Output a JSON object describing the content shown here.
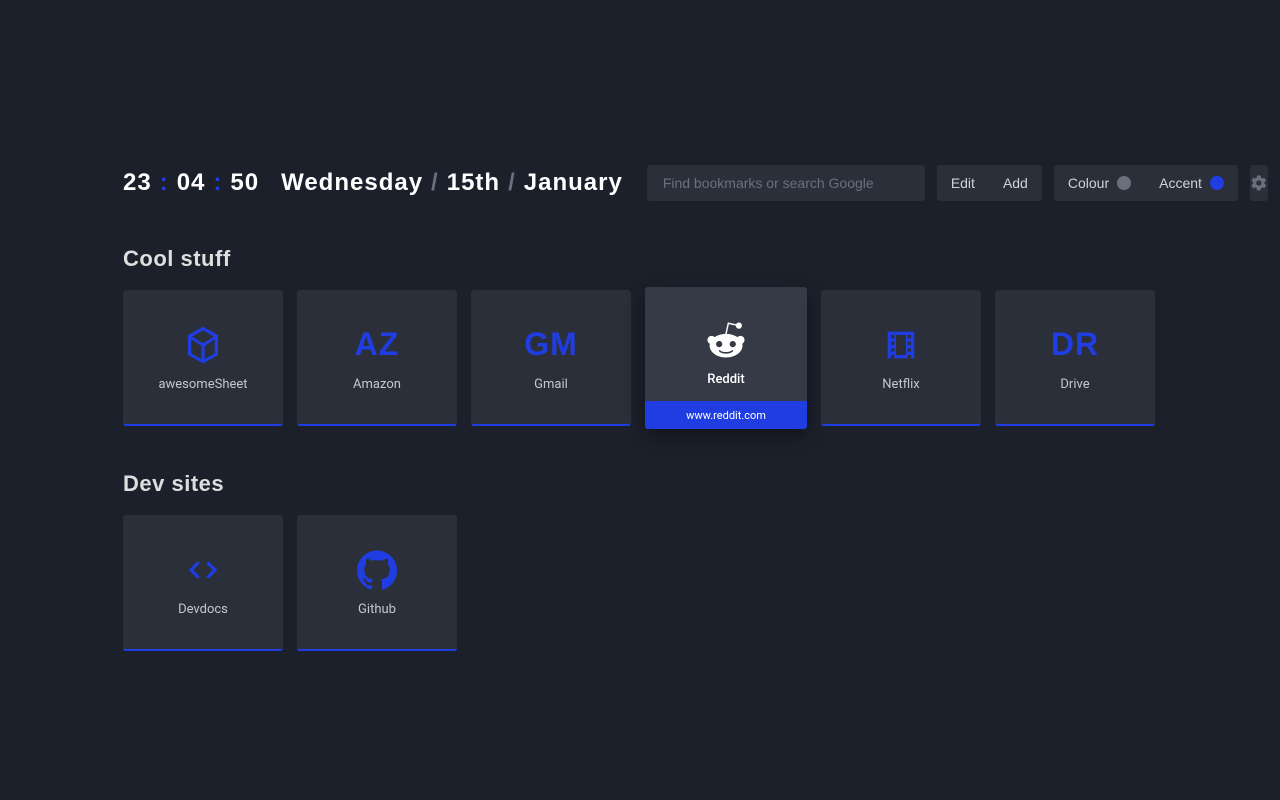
{
  "clock": {
    "hours": "23",
    "minutes": "04",
    "seconds": "50",
    "day": "Wednesday",
    "date": "15th",
    "month": "January"
  },
  "search": {
    "placeholder": "Find bookmarks or search Google"
  },
  "actions": {
    "edit": "Edit",
    "add": "Add",
    "colour": "Colour",
    "accent": "Accent"
  },
  "colors": {
    "accent": "#1f3de0",
    "colour_swatch": "#6a6f7e",
    "bg": "#1c202b",
    "tile": "#2b2f3a"
  },
  "sections": [
    {
      "title": "Cool stuff",
      "tiles": [
        {
          "label": "awesomeSheet",
          "display": "icon",
          "icon": "d20",
          "hover": false
        },
        {
          "label": "Amazon",
          "display": "text",
          "text": "AZ",
          "hover": false
        },
        {
          "label": "Gmail",
          "display": "text",
          "text": "GM",
          "hover": false
        },
        {
          "label": "Reddit",
          "display": "icon",
          "icon": "reddit",
          "hover": true,
          "url": "www.reddit.com"
        },
        {
          "label": "Netflix",
          "display": "icon",
          "icon": "film",
          "hover": false
        },
        {
          "label": "Drive",
          "display": "text",
          "text": "DR",
          "hover": false
        }
      ]
    },
    {
      "title": "Dev sites",
      "tiles": [
        {
          "label": "Devdocs",
          "display": "icon",
          "icon": "code",
          "hover": false
        },
        {
          "label": "Github",
          "display": "icon",
          "icon": "github",
          "hover": false
        }
      ]
    }
  ]
}
